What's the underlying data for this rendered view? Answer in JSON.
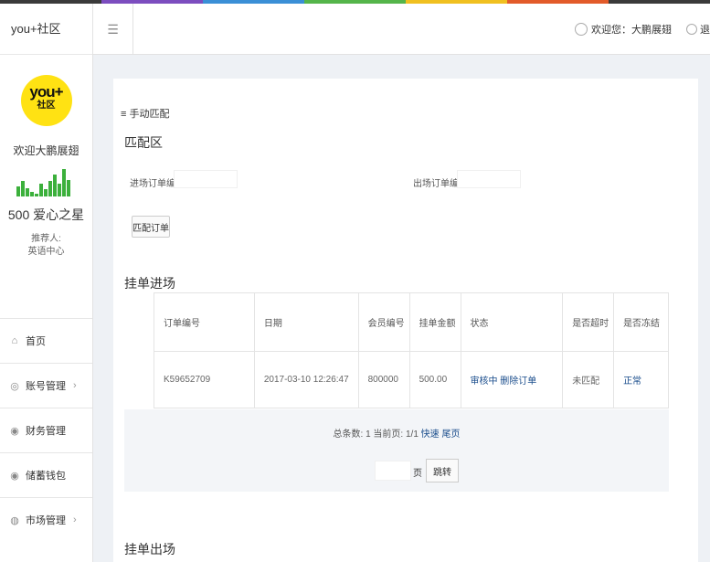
{
  "brand": {
    "name": "you+社区"
  },
  "logo": {
    "line1": "you+",
    "line2": "社区"
  },
  "profile": {
    "welcome": "欢迎大鹏展翅",
    "score": "500 爱心之星",
    "recommender_label": "推荐人:",
    "recommender_value": "英语中心"
  },
  "signal_levels": [
    0.35,
    0.55,
    0.3,
    0.15,
    0.1,
    0.45,
    0.25,
    0.55,
    0.8,
    0.45,
    1.0,
    0.6
  ],
  "nav": {
    "items": [
      {
        "label": "首页",
        "icon": "home-icon"
      },
      {
        "label": "账号管理",
        "icon": "user-icon",
        "chevron": "›"
      },
      {
        "label": "财务管理",
        "icon": "finance-icon"
      },
      {
        "label": "储蓄钱包",
        "icon": "wallet-icon"
      },
      {
        "label": "市场管理",
        "icon": "market-icon",
        "chevron": "›"
      }
    ]
  },
  "header": {
    "menu_glyph": "☰",
    "greeting": "欢迎您：大鹏展翅",
    "logout": "退"
  },
  "main": {
    "breadcrumb": "手动匹配",
    "match_section": {
      "title": "匹配区",
      "in_order_label": "进场订单编号:",
      "out_order_label": "出场订单编号:",
      "match_button": "匹配订单"
    },
    "entry_section": {
      "title": "挂单进场",
      "columns": [
        "订单编号",
        "日期",
        "会员编号",
        "挂单金额",
        "状态",
        "是否超时",
        "是否冻结"
      ],
      "rows": [
        [
          "K59652709",
          "2017-03-10 12:26:47",
          "800000",
          "500.00",
          "审核中 删除订单",
          "未匹配",
          "正常"
        ]
      ]
    },
    "pager": {
      "info": "总条数: 1 当前页: 1/1",
      "first": "快速",
      "last": "尾页",
      "page_unit": "页",
      "jump_button": "跳转"
    },
    "exit_section": {
      "title": "挂单出场"
    }
  },
  "colors": {
    "accent_strip": [
      "#3a3a3a",
      "#7c4dbf",
      "#3a8fd6",
      "#55b54a",
      "#f0c020",
      "#e25b2a",
      "#3a3a3a"
    ],
    "logo_yellow": "#ffe213",
    "signal_green": "#3cb03c",
    "link_blue": "#1a4d8c"
  }
}
